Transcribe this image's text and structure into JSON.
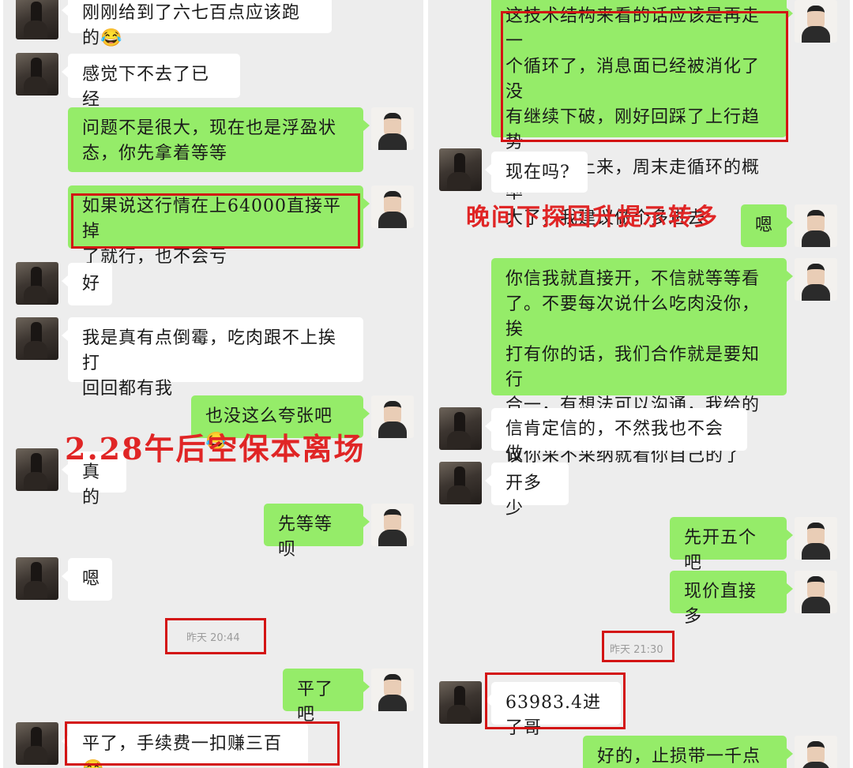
{
  "left": {
    "m1": "刚刚给到了六七百点应该跑的",
    "m2": "感觉下不去了已经",
    "m3_l1": "问题不是很大，现在也是浮盈状",
    "m3_l2": "态，你先拿着等等",
    "m4_l1": "如果说这行情在上64000直接平掉",
    "m4_l2": "了就行，也不会亏",
    "m5": "好",
    "m6_l1": "我是真有点倒霉，吃肉跟不上挨打",
    "m6_l2": "回回都有我",
    "m7": "也没这么夸张吧",
    "m8": "真的",
    "m9": "先等等呗",
    "m10": "嗯",
    "ts1": "昨天 20:44",
    "m11": "平了吧",
    "m12": "平了，手续费一扣赚三百",
    "overlay": "2.28午后空保本离场"
  },
  "right": {
    "m1_l1": "这技术结构来看的话应该是再走一",
    "m1_l2": "个循环了，消息面已经被消化了没",
    "m1_l3": "有继续下破，刚好回踩了上行趋势",
    "m1_l4": "线后反弹上来，周末走循环的概率",
    "m1_l5": "大了，我建议做个多进去",
    "m2": "现在吗?",
    "m3": "嗯",
    "m4_l1": "你信我就直接开，不信就等等看",
    "m4_l2": "了。不要每次说什么吃肉没你，挨",
    "m4_l3": "打有你的话，我们合作就是要知行",
    "m4_l4": "合一，有想法可以沟通，我给的建",
    "m4_l5": "议你采不采纳就看你自己的了",
    "m5": "信肯定信的，不然我也不会做",
    "m6": "开多少",
    "m7": "先开五个吧",
    "m8": "现价直接多",
    "ts1": "昨天 21:30",
    "m9": "63983.4进了哥",
    "m10": "好的，止损带一千点先",
    "overlay": "晚间下探回升提示转多"
  },
  "emoji": {
    "laugh": "😂"
  },
  "colors": {
    "out_bubble": "#95ec69",
    "in_bubble": "#ffffff",
    "annotation": "#d31414",
    "background": "#ededed"
  }
}
